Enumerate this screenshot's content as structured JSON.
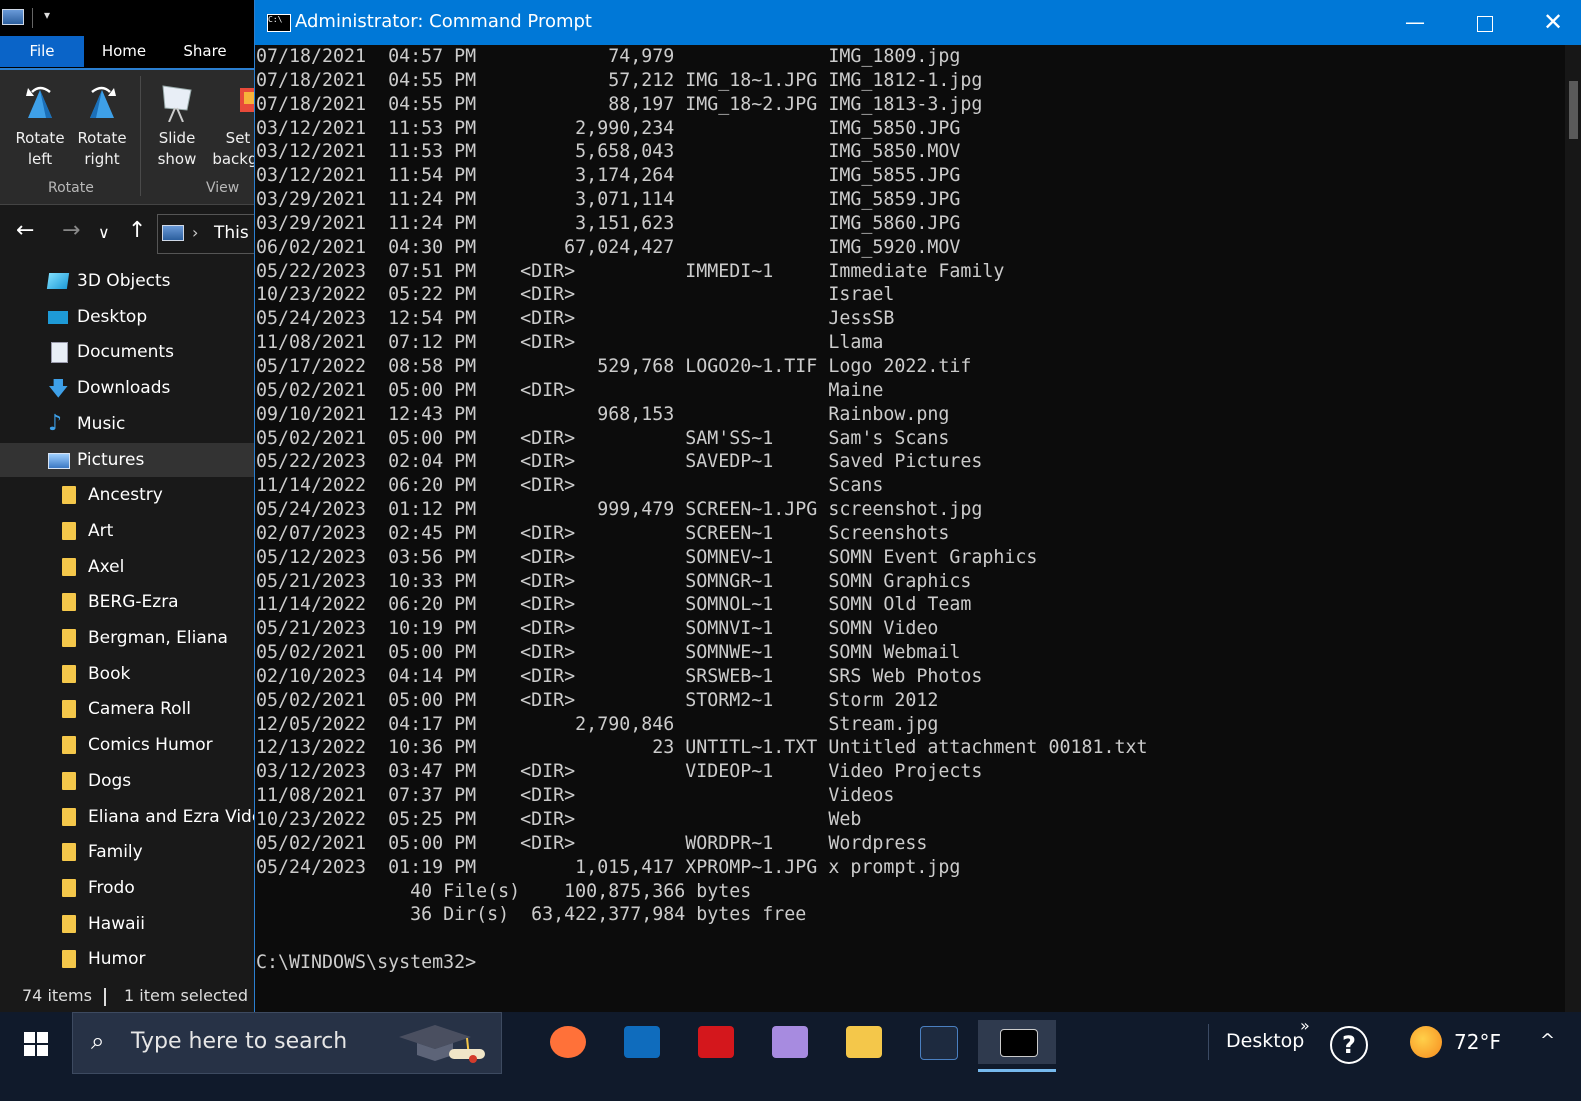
{
  "explorer": {
    "tabs": {
      "file": "File",
      "home": "Home",
      "share": "Share"
    },
    "ribbon": {
      "rotate_left": [
        "Rotate",
        "left"
      ],
      "rotate_right": [
        "Rotate",
        "right"
      ],
      "slide_show": [
        "Slide",
        "show"
      ],
      "set_background": [
        "Set",
        "backgr"
      ],
      "group_rotate": "Rotate",
      "group_view": "View"
    },
    "address_crumb": "This P",
    "tree": [
      {
        "label": "3D Objects",
        "icon": "3d-objects-icon",
        "level": "top"
      },
      {
        "label": "Desktop",
        "icon": "desktop-icon",
        "level": "top"
      },
      {
        "label": "Documents",
        "icon": "documents-icon",
        "level": "top"
      },
      {
        "label": "Downloads",
        "icon": "downloads-icon",
        "level": "top"
      },
      {
        "label": "Music",
        "icon": "music-icon",
        "level": "top"
      },
      {
        "label": "Pictures",
        "icon": "pictures-icon",
        "level": "top",
        "selected": true
      },
      {
        "label": "Ancestry",
        "icon": "folder-icon",
        "level": "sub"
      },
      {
        "label": "Art",
        "icon": "folder-icon",
        "level": "sub"
      },
      {
        "label": "Axel",
        "icon": "folder-icon",
        "level": "sub"
      },
      {
        "label": "BERG-Ezra",
        "icon": "folder-icon",
        "level": "sub"
      },
      {
        "label": "Bergman, Eliana",
        "icon": "folder-icon",
        "level": "sub"
      },
      {
        "label": "Book",
        "icon": "folder-icon",
        "level": "sub"
      },
      {
        "label": "Camera Roll",
        "icon": "folder-icon",
        "level": "sub"
      },
      {
        "label": "Comics Humor",
        "icon": "folder-icon",
        "level": "sub"
      },
      {
        "label": "Dogs",
        "icon": "folder-icon",
        "level": "sub"
      },
      {
        "label": "Eliana and Ezra Video",
        "icon": "folder-icon",
        "level": "sub"
      },
      {
        "label": "Family",
        "icon": "folder-icon",
        "level": "sub"
      },
      {
        "label": "Frodo",
        "icon": "folder-icon",
        "level": "sub"
      },
      {
        "label": "Hawaii",
        "icon": "folder-icon",
        "level": "sub"
      },
      {
        "label": "Humor",
        "icon": "folder-icon",
        "level": "sub"
      }
    ],
    "status": {
      "items": "74 items",
      "selected": "1 item selected"
    }
  },
  "cmd": {
    "title": "Administrator: Command Prompt",
    "window_buttons": {
      "minimize": "—",
      "close": "✕"
    },
    "lines": [
      "07/18/2021  04:57 PM            74,979              IMG_1809.jpg",
      "07/18/2021  04:55 PM            57,212 IMG_18~1.JPG IMG_1812-1.jpg",
      "07/18/2021  04:55 PM            88,197 IMG_18~2.JPG IMG_1813-3.jpg",
      "03/12/2021  11:53 PM         2,990,234              IMG_5850.JPG",
      "03/12/2021  11:53 PM         5,658,043              IMG_5850.MOV",
      "03/12/2021  11:54 PM         3,174,264              IMG_5855.JPG",
      "03/29/2021  11:24 PM         3,071,114              IMG_5859.JPG",
      "03/29/2021  11:24 PM         3,151,623              IMG_5860.JPG",
      "06/02/2021  04:30 PM        67,024,427              IMG_5920.MOV",
      "05/22/2023  07:51 PM    <DIR>          IMMEDI~1     Immediate Family",
      "10/23/2022  05:22 PM    <DIR>                       Israel",
      "05/24/2023  12:54 PM    <DIR>                       JessSB",
      "11/08/2021  07:12 PM    <DIR>                       Llama",
      "05/17/2022  08:58 PM           529,768 LOGO20~1.TIF Logo 2022.tif",
      "05/02/2021  05:00 PM    <DIR>                       Maine",
      "09/10/2021  12:43 PM           968,153              Rainbow.png",
      "05/02/2021  05:00 PM    <DIR>          SAM'SS~1     Sam's Scans",
      "05/22/2023  02:04 PM    <DIR>          SAVEDP~1     Saved Pictures",
      "11/14/2022  06:20 PM    <DIR>                       Scans",
      "05/24/2023  01:12 PM           999,479 SCREEN~1.JPG screenshot.jpg",
      "02/07/2023  02:45 PM    <DIR>          SCREEN~1     Screenshots",
      "05/12/2023  03:56 PM    <DIR>          SOMNEV~1     SOMN Event Graphics",
      "05/21/2023  10:33 PM    <DIR>          SOMNGR~1     SOMN Graphics",
      "11/14/2022  06:20 PM    <DIR>          SOMNOL~1     SOMN Old Team",
      "05/21/2023  10:19 PM    <DIR>          SOMNVI~1     SOMN Video",
      "05/02/2021  05:00 PM    <DIR>          SOMNWE~1     SOMN Webmail",
      "02/10/2023  04:14 PM    <DIR>          SRSWEB~1     SRS Web Photos",
      "05/02/2021  05:00 PM    <DIR>          STORM2~1     Storm 2012",
      "12/05/2022  04:17 PM         2,790,846              Stream.jpg",
      "12/13/2022  10:36 PM                23 UNTITL~1.TXT Untitled attachment 00181.txt",
      "03/12/2023  03:47 PM    <DIR>          VIDEOP~1     Video Projects",
      "11/08/2021  07:37 PM    <DIR>                       Videos",
      "10/23/2022  05:25 PM    <DIR>                       Web",
      "05/02/2021  05:00 PM    <DIR>          WORDPR~1     Wordpress",
      "05/24/2023  01:19 PM         1,015,417 XPROMP~1.JPG x prompt.jpg",
      "              40 File(s)    100,875,366 bytes",
      "              36 Dir(s)  63,422,377,984 bytes free",
      "",
      "C:\\WINDOWS\\system32>"
    ]
  },
  "taskbar": {
    "search_placeholder": "Type here to search",
    "apps": [
      {
        "name": "firefox-icon",
        "color": "#ff7139"
      },
      {
        "name": "outlook-icon",
        "color": "#0f6cbd"
      },
      {
        "name": "acrobat-icon",
        "color": "#d4171c"
      },
      {
        "name": "onenote-like-icon",
        "color": "#a78be0"
      },
      {
        "name": "file-explorer-icon",
        "color": "#f4c74a"
      },
      {
        "name": "app-dark-icon",
        "color": "#1d2a3f"
      },
      {
        "name": "command-prompt-icon",
        "color": "#000000",
        "active": true
      }
    ],
    "desktop_label": "Desktop",
    "overflow": "»",
    "help": "?",
    "temperature": "72°F",
    "tray_chevron": "^"
  },
  "colors": {
    "accent": "#0078d7",
    "console_bg": "#0c0c0c",
    "console_text": "#cccccc",
    "explorer_bg": "#191919",
    "taskbar_bg": "#101a2b",
    "folder": "#f4c74a"
  }
}
